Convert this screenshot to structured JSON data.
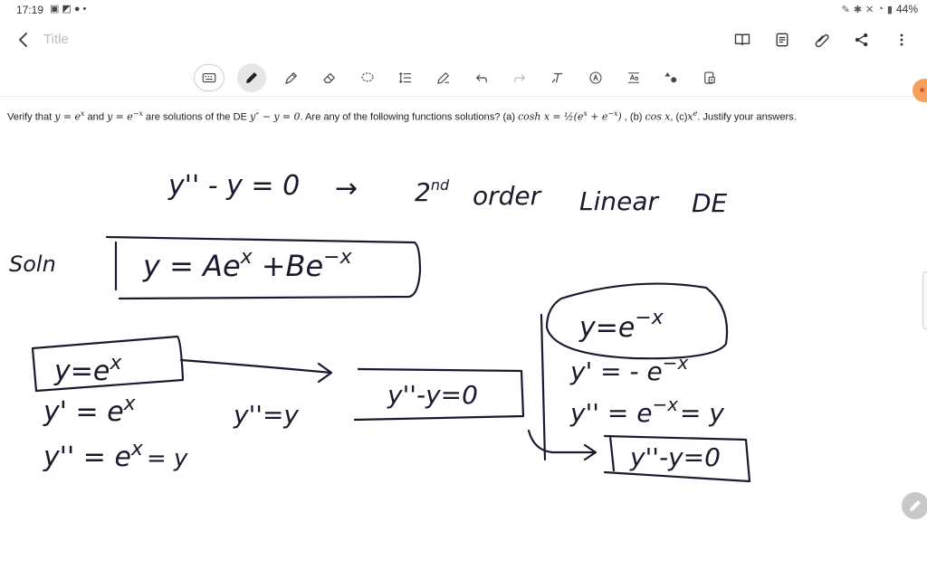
{
  "status_bar": {
    "time": "17:19",
    "left_icons": [
      "image-icon",
      "video-icon",
      "location-icon",
      "dot-icon"
    ],
    "right_icons": [
      "pen-icon",
      "bluetooth-icon",
      "mute-icon",
      "wifi-icon",
      "signal-icon"
    ],
    "battery": "44%"
  },
  "app_bar": {
    "title_placeholder": "Title",
    "actions": [
      "book-icon",
      "document-icon",
      "attachment-icon",
      "share-icon",
      "more-icon"
    ]
  },
  "toolbar": {
    "tools": [
      "keyboard-icon",
      "pen-icon",
      "highlighter-icon",
      "eraser-icon",
      "lasso-icon",
      "line-spacing-icon",
      "pen-settings-icon",
      "undo-icon",
      "redo-icon",
      "text-style-icon",
      "text-icon",
      "text-box-icon",
      "shapes-icon",
      "export-icon"
    ],
    "active_tool": "pen-icon"
  },
  "question": {
    "p1": "Verify that ",
    "m1": "y = e",
    "m1sup": "x",
    "p2": " and ",
    "m2": "y = e",
    "m2sup": "−x",
    "p3": " are solutions of the DE ",
    "m3": "y″ − y = 0",
    "p4": ". Are any of the following functions solutions? (a) ",
    "m4": "cosh x = ",
    "m4half": "½",
    "m4b": "(e",
    "m4bsup": "x",
    "m4c": " + e",
    "m4csup": "−x",
    "m4d": ")",
    "p5": " , (b) ",
    "m5": "cos x",
    "p6": ", (c)",
    "m6": "x",
    "m6sup": "e",
    "p7": ". Justify your answers."
  },
  "handwriting": {
    "line1_eq": "y'' - y = 0",
    "line1_arrow": "→",
    "line1_order": "2",
    "line1_order_sup": "nd",
    "line1_order_word": "order",
    "line1_linear": "Linear",
    "line1_de": "DE",
    "soln_label": "Soln",
    "general_solution": "y = Ae",
    "gen_sup1": "x",
    "general_solution_b": "+Be",
    "gen_sup2": "−x",
    "left_box": "y=e",
    "left_box_sup": "x",
    "left_d1": "y' = e",
    "left_d1_sup": "x",
    "left_d2": "y'' = e",
    "left_d2_sup": "x",
    "left_d2_tail": "= y",
    "middle_label": "y''=y",
    "middle_box": "y''-y=0",
    "right_oval": "y=e",
    "right_oval_sup": "−x",
    "right_d1": "y' = - e",
    "right_d1_sup": "−x",
    "right_d2": "y'' = e",
    "right_d2_sup": "−x",
    "right_d2_tail": "= y",
    "right_box": "y''-y=0"
  },
  "colors": {
    "ink": "#1a1a2e",
    "accent": "#f4a15d",
    "ui_icon": "#444444"
  }
}
